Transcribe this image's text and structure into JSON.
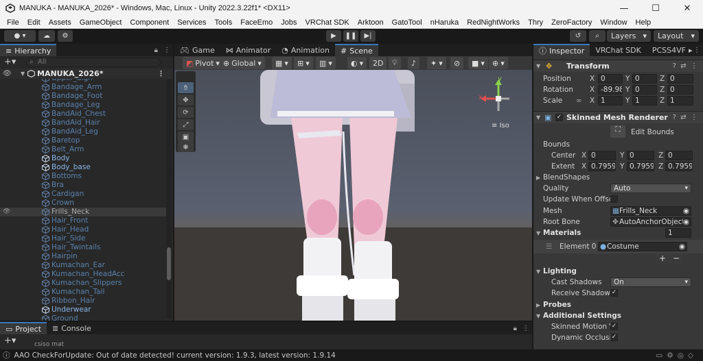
{
  "window": {
    "title": "MANUKA - MANUKA_2026* - Windows, Mac, Linux - Unity 2022.3.22f1* <DX11>"
  },
  "menu": [
    "File",
    "Edit",
    "Assets",
    "GameObject",
    "Component",
    "Services",
    "Tools",
    "FaceEmo",
    "Jobs",
    "VRChat SDK",
    "Arktoon",
    "GatoTool",
    "nHaruka",
    "RedNightWorks",
    "Thry",
    "ZeroFactory",
    "Window",
    "Help"
  ],
  "toolbar": {
    "layers_label": "Layers",
    "layout_label": "Layout"
  },
  "hierarchy": {
    "tab_label": "Hierarchy",
    "search_placeholder": "All",
    "scene_name": "MANUKA_2026*",
    "items": [
      {
        "name": "Upper_Sign",
        "active": false
      },
      {
        "name": "Bandage_Arm",
        "active": false
      },
      {
        "name": "Bandage_Foot",
        "active": false
      },
      {
        "name": "Bandage_Leg",
        "active": false
      },
      {
        "name": "BandAid_Chest",
        "active": false
      },
      {
        "name": "BandAid_Hair",
        "active": false
      },
      {
        "name": "BandAid_Leg",
        "active": false
      },
      {
        "name": "Baretop",
        "active": false
      },
      {
        "name": "Belt_Arm",
        "active": false
      },
      {
        "name": "Body",
        "active": true
      },
      {
        "name": "Body_base",
        "active": true
      },
      {
        "name": "Bottoms",
        "active": false
      },
      {
        "name": "Bra",
        "active": false
      },
      {
        "name": "Cardigan",
        "active": false
      },
      {
        "name": "Crown",
        "active": false
      },
      {
        "name": "Frills_Neck",
        "active": false,
        "selected": true
      },
      {
        "name": "Hair_Front",
        "active": false
      },
      {
        "name": "Hair_Head",
        "active": false
      },
      {
        "name": "Hair_Side",
        "active": false
      },
      {
        "name": "Hair_Twintails",
        "active": false
      },
      {
        "name": "Hairpin",
        "active": false
      },
      {
        "name": "Kumachan_Ear",
        "active": false
      },
      {
        "name": "Kumachan_HeadAcc",
        "active": false
      },
      {
        "name": "Kumachan_Slippers",
        "active": false
      },
      {
        "name": "Kumachan_Tail",
        "active": false
      },
      {
        "name": "Ribbon_Hair",
        "active": false
      },
      {
        "name": "Underwear",
        "active": true
      },
      {
        "name": "Ground",
        "active": false
      }
    ]
  },
  "scene": {
    "tabs": [
      "Game",
      "Animator",
      "Animation",
      "Scene"
    ],
    "pivot_label": "Pivot",
    "global_label": "Global",
    "mode_2d": "2D",
    "iso_label": "Iso",
    "gizmo_x": "x",
    "gizmo_y": "y"
  },
  "inspector": {
    "tabs": [
      "Inspector",
      "VRChat SDK",
      "PCSS4VF"
    ],
    "transform": {
      "title": "Transform",
      "position": {
        "label": "Position",
        "x": "0",
        "y": "0",
        "z": "0"
      },
      "rotation": {
        "label": "Rotation",
        "x": "-89.98",
        "y": "0",
        "z": "0"
      },
      "scale": {
        "label": "Scale",
        "x": "1",
        "y": "1",
        "z": "1"
      }
    },
    "smr": {
      "title": "Skinned Mesh Renderer",
      "edit_bounds": "Edit Bounds",
      "bounds_label": "Bounds",
      "center": {
        "label": "Center",
        "x": "0",
        "y": "0",
        "z": "0"
      },
      "extent": {
        "label": "Extent",
        "x": "0.79594",
        "y": "0.79594",
        "z": "0.79594"
      },
      "blendshapes": "BlendShapes",
      "quality_label": "Quality",
      "quality_value": "Auto",
      "update_offscreen": "Update When Offscr",
      "mesh_label": "Mesh",
      "mesh_value": "Frills_Neck",
      "rootbone_label": "Root Bone",
      "rootbone_value": "AutoAnchorObject (",
      "materials_label": "Materials",
      "materials_count": "1",
      "element0_label": "Element 0",
      "element0_value": "Costume",
      "plus": "+",
      "minus": "−",
      "lighting": "Lighting",
      "cast_shadows_label": "Cast Shadows",
      "cast_shadows_value": "On",
      "receive_shadows_label": "Receive Shadows",
      "probes": "Probes",
      "additional": "Additional Settings",
      "skinned_motion": "Skinned Motion V",
      "dynamic_occlusion": "Dynamic Occlusic"
    }
  },
  "project": {
    "tabs": [
      "Project",
      "Console"
    ],
    "partial_item": "csiso mat"
  },
  "status": {
    "message": "AAO CheckForUpdate: Out of date detected! current version: 1.9.3, latest version: 1.9.14"
  },
  "colors": {
    "accent": "#3a79bb",
    "active_item": "#8ab6e8",
    "inactive_item": "#5a82ad"
  }
}
